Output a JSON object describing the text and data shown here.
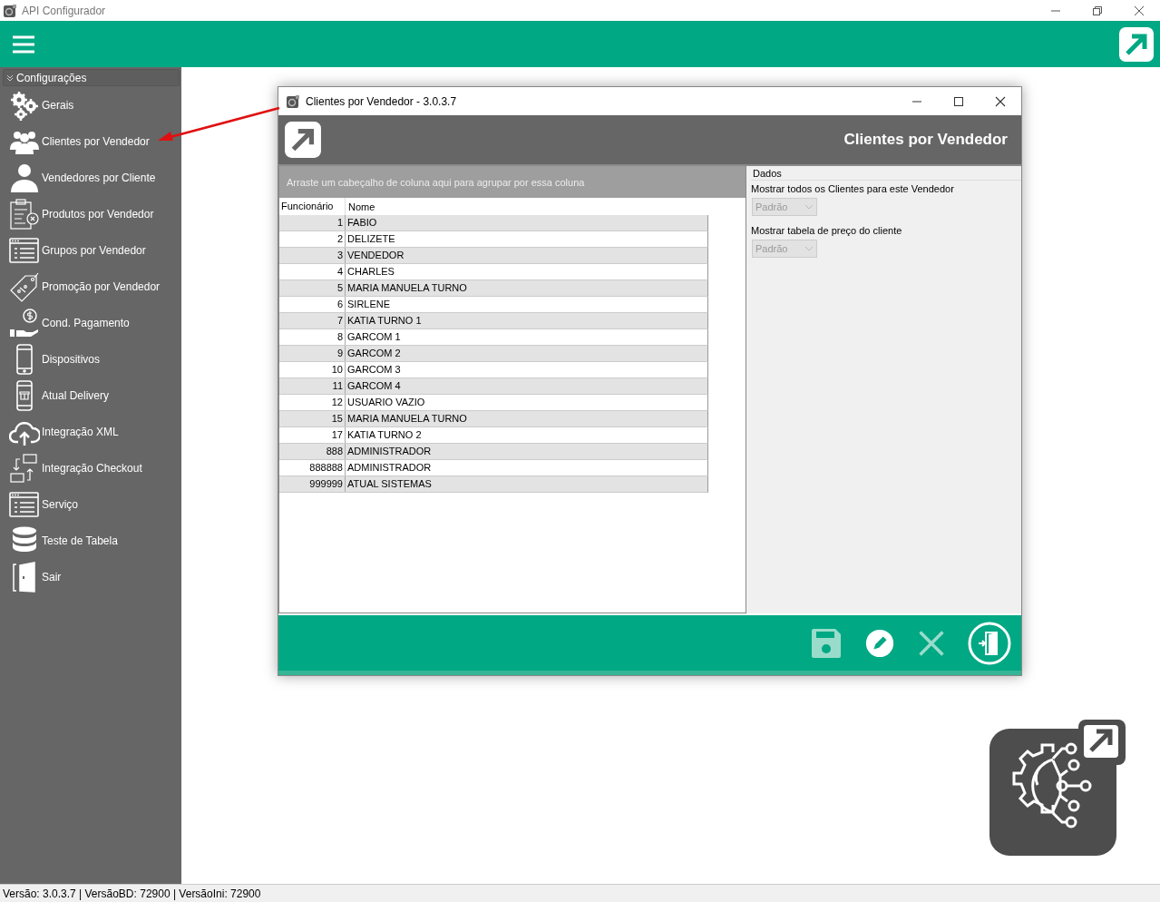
{
  "window": {
    "title": "API Configurador"
  },
  "sidebar": {
    "section": "Configurações",
    "expanded": true,
    "items": [
      {
        "label": "Gerais",
        "kind": "gears"
      },
      {
        "label": "Clientes por Vendedor",
        "kind": "people"
      },
      {
        "label": "Vendedores por Cliente",
        "kind": "person"
      },
      {
        "label": "Produtos por Vendedor",
        "kind": "clipboard"
      },
      {
        "label": "Grupos por Vendedor",
        "kind": "listwindow"
      },
      {
        "label": "Promoção por Vendedor",
        "kind": "tag"
      },
      {
        "label": "Cond. Pagamento",
        "kind": "payment"
      },
      {
        "label": "Dispositivos",
        "kind": "phone"
      },
      {
        "label": "Atual Delivery",
        "kind": "delivery"
      },
      {
        "label": "Integração XML",
        "kind": "cloud"
      },
      {
        "label": "Integração Checkout",
        "kind": "sync"
      },
      {
        "label": "Serviço",
        "kind": "listwindow"
      },
      {
        "label": "Teste de Tabela",
        "kind": "database"
      },
      {
        "label": "Sair",
        "kind": "door"
      }
    ]
  },
  "dialog": {
    "title": "Clientes por Vendedor - 3.0.3.7",
    "heading": "Clientes por Vendedor",
    "grid": {
      "group_hint": "Arraste um cabeçalho de coluna aqui para agrupar por essa coluna",
      "columns": [
        "Funcionário",
        "Nome"
      ],
      "rows": [
        [
          "1",
          "FABIO"
        ],
        [
          "2",
          "DELIZETE"
        ],
        [
          "3",
          "VENDEDOR"
        ],
        [
          "4",
          "CHARLES"
        ],
        [
          "5",
          "MARIA MANUELA TURNO"
        ],
        [
          "6",
          "SIRLENE"
        ],
        [
          "7",
          "KATIA TURNO 1"
        ],
        [
          "8",
          "GARCOM 1"
        ],
        [
          "9",
          "GARCOM 2"
        ],
        [
          "10",
          "GARCOM 3"
        ],
        [
          "11",
          "GARCOM 4"
        ],
        [
          "12",
          "USUARIO VAZIO"
        ],
        [
          "15",
          "MARIA MANUELA TURNO"
        ],
        [
          "17",
          "KATIA TURNO 2"
        ],
        [
          "888",
          "ADMINISTRADOR"
        ],
        [
          "888888",
          "ADMINISTRADOR"
        ],
        [
          "999999",
          "ATUAL SISTEMAS"
        ]
      ]
    },
    "panel": {
      "title": "Dados",
      "fields": [
        {
          "label": "Mostrar todos os Clientes para este Vendedor",
          "value": "Padrão",
          "disabled": true
        },
        {
          "label": "Mostrar tabela de preço do cliente",
          "value": "Padrão",
          "disabled": true
        }
      ]
    },
    "toolbar": [
      {
        "kind": "save",
        "disabled": true
      },
      {
        "kind": "edit",
        "disabled": false
      },
      {
        "kind": "cancel",
        "disabled": true
      },
      {
        "kind": "exit",
        "disabled": false
      }
    ]
  },
  "status_bar": "Versão: 3.0.3.7 | VersãoBD: 72900 | VersãoIni: 72900"
}
